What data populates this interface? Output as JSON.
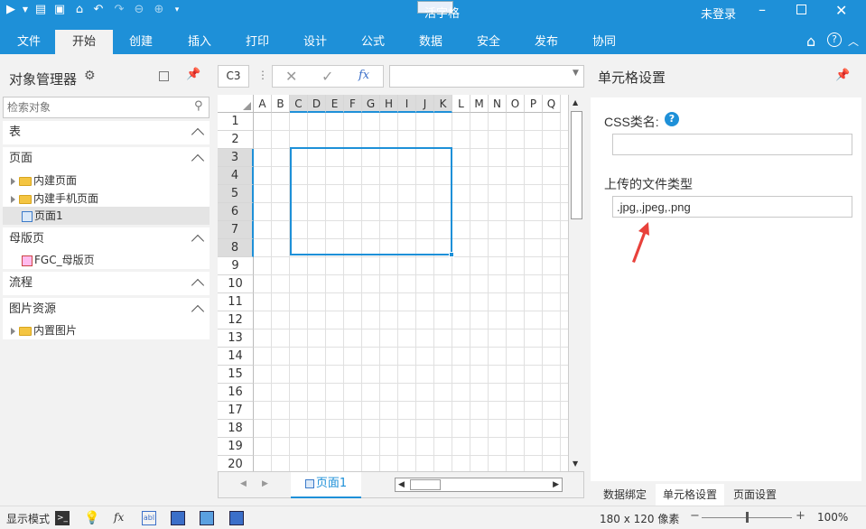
{
  "title": {
    "app": "活字格",
    "login": "未登录"
  },
  "tabs": [
    "文件",
    "开始",
    "创建",
    "插入",
    "打印",
    "设计",
    "公式",
    "数据",
    "安全",
    "发布",
    "协同"
  ],
  "active_tab": "开始",
  "left": {
    "title": "对象管理器",
    "search_placeholder": "检索对象",
    "sections": {
      "table": "表",
      "page": "页面",
      "master": "母版页",
      "flow": "流程",
      "image": "图片资源"
    },
    "items": {
      "builtin_page": "内建页面",
      "builtin_mobile": "内建手机页面",
      "page1": "页面1",
      "fgc_master": "FGC_母版页",
      "builtin_image": "内置图片"
    }
  },
  "formula": {
    "cell_ref": "C3",
    "fx": "fx"
  },
  "grid": {
    "columns": [
      "A",
      "B",
      "C",
      "D",
      "E",
      "F",
      "G",
      "H",
      "I",
      "J",
      "K",
      "L",
      "M",
      "N",
      "O",
      "P",
      "Q"
    ],
    "rows": [
      "1",
      "2",
      "3",
      "4",
      "5",
      "6",
      "7",
      "8",
      "9",
      "10",
      "11",
      "12",
      "13",
      "14",
      "15",
      "16",
      "17",
      "18",
      "19",
      "20"
    ],
    "sheet_tab": "页面1"
  },
  "right": {
    "title": "单元格设置",
    "css_label": "CSS类名:",
    "css_value": "",
    "upload_label": "上传的文件类型",
    "upload_value": ".jpg,.jpeg,.png",
    "bottom_tabs": [
      "数据绑定",
      "单元格设置",
      "页面设置"
    ]
  },
  "status": {
    "mode": "显示模式",
    "size": "180 x 120 像素",
    "zoom": "100%",
    "zoom_level": 0.5
  },
  "colors": {
    "brand": "#1e90d8",
    "selection": "#1e90d8",
    "arrow": "#e8413b"
  }
}
